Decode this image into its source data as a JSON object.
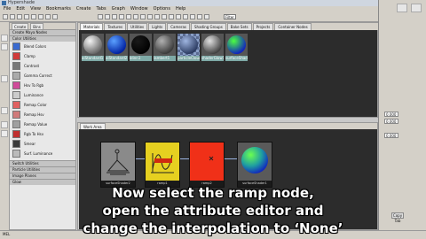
{
  "window": {
    "title": "Hypershade"
  },
  "menubar": [
    "File",
    "Edit",
    "View",
    "Bookmarks",
    "Create",
    "Tabs",
    "Graph",
    "Window",
    "Options",
    "Help"
  ],
  "toolbar": {
    "filter_field": "Filter"
  },
  "create_panel": {
    "tabs": [
      "Create",
      "Bins"
    ],
    "sections": {
      "maya_nodes": "Create Maya Nodes",
      "utilities": "Color Utilities",
      "mental_ray": "Switch Utilities",
      "particle": "Particle Utilities",
      "image_planes": "Image Planes",
      "glow": "Glow"
    },
    "items": [
      {
        "label": "Blend Colors",
        "color": "#3a6ad0"
      },
      {
        "label": "Clamp",
        "color": "#d03a3a"
      },
      {
        "label": "Contrast",
        "color": "#777777"
      },
      {
        "label": "Gamma Correct",
        "color": "#aaaaaa"
      },
      {
        "label": "Hsv To Rgb",
        "color": "#d04a9a"
      },
      {
        "label": "Luminance",
        "color": "#cccccc"
      },
      {
        "label": "Remap Color",
        "color": "#e06060"
      },
      {
        "label": "Remap Hsv",
        "color": "#d07a7a"
      },
      {
        "label": "Remap Value",
        "color": "#a0a0a0"
      },
      {
        "label": "Rgb To Hsv",
        "color": "#c03030"
      },
      {
        "label": "Smear",
        "color": "#3a3a3a"
      },
      {
        "label": "Surf. Luminance",
        "color": "#bbbbbb"
      }
    ]
  },
  "hypershade": {
    "tabs": [
      "Materials",
      "Textures",
      "Utilities",
      "Lights",
      "Cameras",
      "Shading Groups",
      "Bake Sets",
      "Projects",
      "Container Nodes"
    ],
    "materials": [
      {
        "label": "aiStandard1",
        "color1": "#f4f4f4",
        "color2": "#666666"
      },
      {
        "label": "aiStandard2",
        "color1": "#5aa0ff",
        "color2": "#0020a0"
      },
      {
        "label": "blinn1",
        "color1": "#1a1a1a",
        "color2": "#000000"
      },
      {
        "label": "lambert1",
        "color1": "#b0b0b0",
        "color2": "#3a3a3a"
      },
      {
        "label": "particleCloud1",
        "color1": "#9fb5e0",
        "color2": "#2a3a60"
      },
      {
        "label": "shaderGlow1",
        "color1": "#e0e0e0",
        "color2": "#404040"
      },
      {
        "label": "surfaceShader1",
        "color1": "#4cff40",
        "color2": "#1020c0"
      }
    ],
    "work_area_tab": "Work Area",
    "nodes": [
      {
        "label": "surfaceShader2",
        "bg": "#8a8a8a"
      },
      {
        "label": "ramp1",
        "bg": "#e6d020"
      },
      {
        "label": "ramp2",
        "bg": "#f03018"
      },
      {
        "label": "surfaceShader1",
        "bg": "#5a5a5a"
      }
    ]
  },
  "subtitles": [
    "Now select the ramp node,",
    "open the attribute editor and",
    "change the interpolation to ‘None’"
  ],
  "right_panel": {
    "fields": [
      "0.000",
      "0.000",
      "0.000"
    ],
    "buttons": [
      "Copy Tab"
    ]
  },
  "statusbar": {
    "label": "MEL"
  }
}
